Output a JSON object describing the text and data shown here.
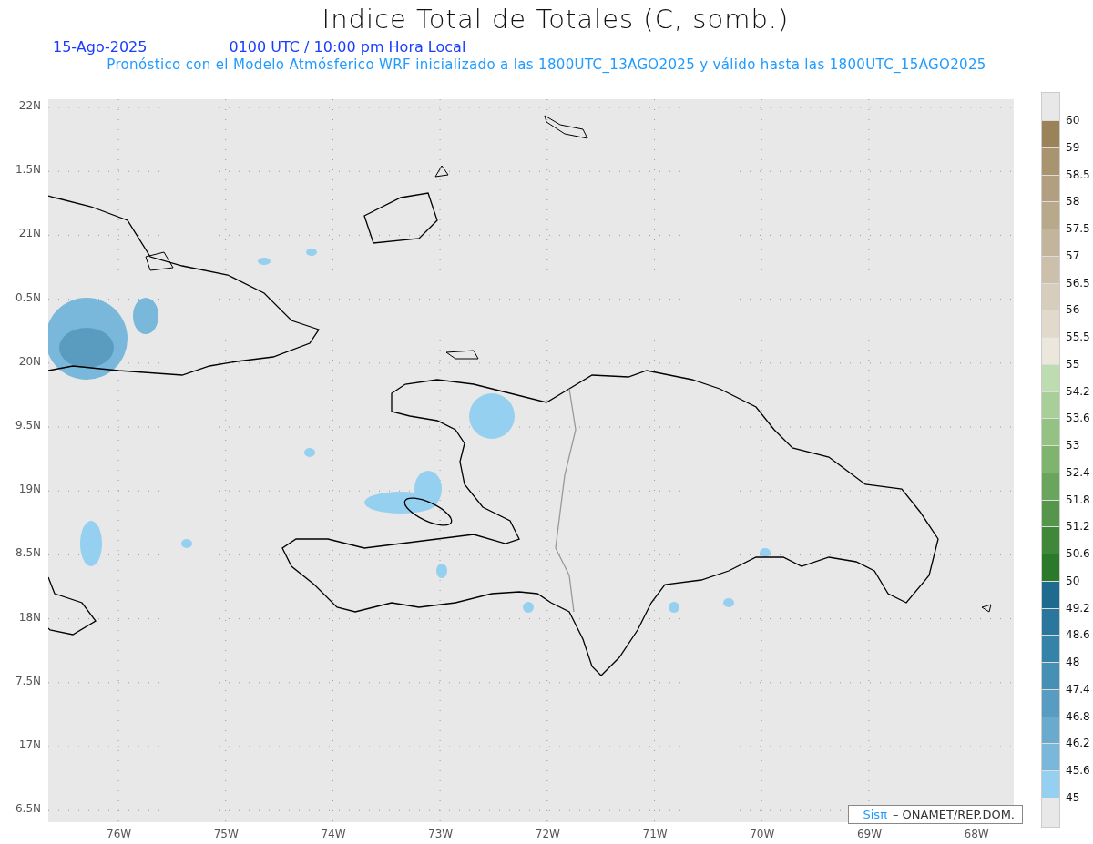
{
  "title": "Indice Total de Totales (C, somb.)",
  "date": "15-Ago-2025",
  "time": "0100 UTC / 10:00 pm Hora Local",
  "subtitle": "Pronóstico con el Modelo Atmósferico WRF inicializado a las 1800UTC_13AGO2025 y válido hasta las  1800UTC_15AGO2025",
  "y_axis": [
    "22N",
    "1.5N",
    "21N",
    "0.5N",
    "20N",
    "9.5N",
    "19N",
    "8.5N",
    "18N",
    "7.5N",
    "17N",
    "6.5N"
  ],
  "x_axis": [
    "76W",
    "75W",
    "74W",
    "73W",
    "72W",
    "71W",
    "70W",
    "69W",
    "68W"
  ],
  "credit": {
    "logo": "Sisπ",
    "text": "– ONAMET/REP.DOM."
  },
  "colorbar": {
    "segments": [
      {
        "label": "60",
        "color": "#9a8259"
      },
      {
        "label": "59",
        "color": "#a99470"
      },
      {
        "label": "58.5",
        "color": "#b19f7f"
      },
      {
        "label": "58",
        "color": "#b9a98b"
      },
      {
        "label": "57.5",
        "color": "#c3b59c"
      },
      {
        "label": "57",
        "color": "#ccc0aa"
      },
      {
        "label": "56.5",
        "color": "#d6cdbc"
      },
      {
        "label": "56",
        "color": "#e1d9cc"
      },
      {
        "label": "55.5",
        "color": "#ece7dd"
      },
      {
        "label": "55",
        "color": "#bddcaf"
      },
      {
        "label": "54.2",
        "color": "#a7cf97"
      },
      {
        "label": "53.6",
        "color": "#93c283"
      },
      {
        "label": "53",
        "color": "#7eb46e"
      },
      {
        "label": "52.4",
        "color": "#69a55c"
      },
      {
        "label": "51.8",
        "color": "#55964b"
      },
      {
        "label": "51.2",
        "color": "#40873a"
      },
      {
        "label": "50.6",
        "color": "#2b7a2b"
      },
      {
        "label": "50",
        "color": "#1e6b8f"
      },
      {
        "label": "49.2",
        "color": "#2a779d"
      },
      {
        "label": "48.6",
        "color": "#3683a9"
      },
      {
        "label": "48",
        "color": "#4790b5"
      },
      {
        "label": "47.4",
        "color": "#589dc1"
      },
      {
        "label": "46.8",
        "color": "#69aacd"
      },
      {
        "label": "46.2",
        "color": "#79b8da"
      },
      {
        "label": "45.6",
        "color": "#96d0f0"
      }
    ],
    "bottom_label": "45"
  }
}
